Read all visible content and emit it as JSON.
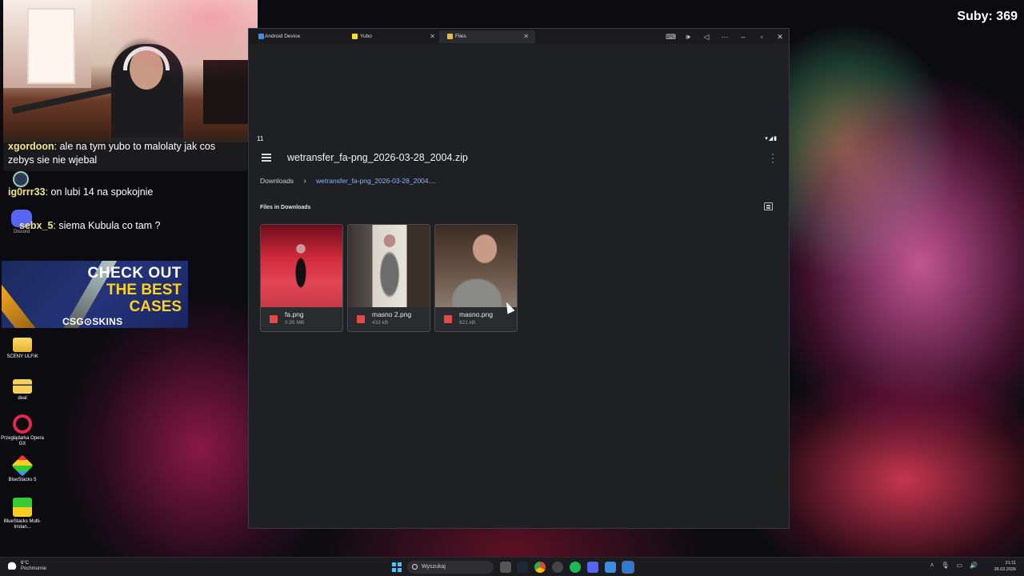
{
  "overlay": {
    "subs_counter": "Suby: 369",
    "chat": [
      {
        "user": "xgordoon",
        "text": ": ale na tym yubo to malolaty jak cos",
        "text2": "zebys sie nie wjebal"
      },
      {
        "user": "ig0rrr33",
        "text": ": on lubi 14 na spokojnie"
      },
      {
        "user": "sebx_5",
        "text": ": siema Kubula co tam ?"
      }
    ],
    "discord_label": "Discord",
    "ad": {
      "line1": "CHECK OUT",
      "line2": "THE BEST",
      "line3": "CASES",
      "brand": "CSG⊙SKINS"
    }
  },
  "desktop_icons": [
    {
      "label": "SCENY ULFIK",
      "icon": "folder-icon"
    },
    {
      "label": "deal",
      "icon": "folder-icon"
    },
    {
      "label": "Przeglądarka Opera GX",
      "icon": "opera-gx-icon"
    },
    {
      "label": "BlueStacks 5",
      "icon": "bluestacks-icon"
    },
    {
      "label": "BlueStacks Multi-Instan...",
      "icon": "bluestacks-multi-icon"
    }
  ],
  "window": {
    "tabs": [
      {
        "label": "Android Device",
        "icon": "android-device-icon"
      },
      {
        "label": "Yubo",
        "icon": "yubo-icon"
      },
      {
        "label": "Files",
        "icon": "files-icon",
        "active": true
      }
    ],
    "controls": [
      "keyboard-icon",
      "volume-icon",
      "back-icon",
      "more-icon",
      "minimize-icon",
      "maximize-icon",
      "close-icon"
    ],
    "status_time": "11",
    "status_icons": "▾◢▮",
    "app_title": "wetransfer_fa-png_2026-03-28_2004.zip",
    "breadcrumb": {
      "root": "Downloads",
      "current": "wetransfer_fa-png_2026-03-28_2004...."
    },
    "section_title": "Files in Downloads",
    "files": [
      {
        "name": "fa.png",
        "size": "0.95 MB"
      },
      {
        "name": "masno 2.png",
        "size": "433 kB"
      },
      {
        "name": "masno.png",
        "size": "621 kB"
      }
    ]
  },
  "taskbar": {
    "weather_temp": "6°C",
    "weather_desc": "Pochmurnie",
    "search_placeholder": "Wyszukaj",
    "time": "21:11",
    "date": "28.03.2026",
    "accent": "#4cc2ff"
  }
}
